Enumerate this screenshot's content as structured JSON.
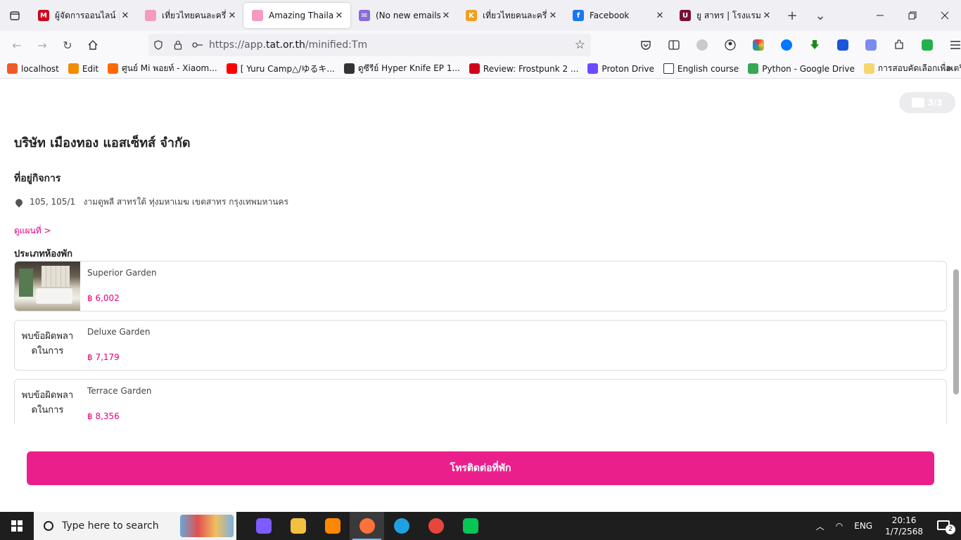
{
  "browser": {
    "tabs": [
      {
        "title": "ผู้จัดการออนไลน์ | ผ",
        "fav_color": "#d0021b",
        "fav_text": "M"
      },
      {
        "title": "เที่ยวไทยคนละครึ่ง",
        "fav_color": "#f59ac0",
        "fav_text": ""
      },
      {
        "title": "Amazing Thailand",
        "fav_color": "#f59ac0",
        "fav_text": "",
        "active": true
      },
      {
        "title": "(No new emails) -",
        "fav_color": "#8a6bd8",
        "fav_text": "✉"
      },
      {
        "title": "เที่ยวไทยคนละครึ่ง",
        "fav_color": "#f0a020",
        "fav_text": "K"
      },
      {
        "title": "Facebook",
        "fav_color": "#1877f2",
        "fav_text": "f"
      },
      {
        "title": "ยู สาทร | โรงแรม บู",
        "fav_color": "#7a0e3a",
        "fav_text": "U"
      }
    ],
    "close_glyph": "✕",
    "new_tab_glyph": "+",
    "tab_list_glyph": "⌄",
    "url_prefix": "https://app.",
    "url_domain": "tat.or.th",
    "url_path": "/minified:Tm",
    "bookmarks": [
      {
        "label": "localhost",
        "color": "#f05a28"
      },
      {
        "label": "Edit",
        "color": "#f08c00"
      },
      {
        "label": "ศูนย์ Mi พอยท์ - Xiaom...",
        "color": "#ff6900"
      },
      {
        "label": "[ Yuru Camp△/ゆるキ...",
        "color": "#ff0000"
      },
      {
        "label": "ดูซีรีย์ Hyper Knife EP 1...",
        "color": "#333333"
      },
      {
        "label": "Review: Frostpunk 2 ...",
        "color": "#d0021b"
      },
      {
        "label": "Proton Drive",
        "color": "#6d4aff"
      },
      {
        "label": "English course",
        "color": "#ffffff"
      },
      {
        "label": "Python - Google Drive",
        "color": "#34a853"
      },
      {
        "label": "การสอบคัดเลือกเพื่อเตรี...",
        "color": "#f5d76e"
      }
    ]
  },
  "page": {
    "photo_counter": "3/3",
    "company_name": "บริษัท เมืองทอง แอสเซ็ทส์ จำกัด",
    "address_heading": "ที่อยู่กิจการ",
    "address": "105, 105/1   งามดูพลี สาทรใต้ ทุ่งมหาเมฆ เขตสาทร กรุงเทพมหานคร",
    "map_link": "ดูแผนที่ >",
    "room_type_heading": "ประเภทห้องพัก",
    "rooms": [
      {
        "name": "Superior Garden",
        "price": "฿ 6,002",
        "image_error": ""
      },
      {
        "name": "Deluxe Garden",
        "price": "฿ 7,179",
        "image_error": "พบข้อผิดพลาดในการ"
      },
      {
        "name": "Terrace Garden",
        "price": "฿ 8,356",
        "image_error": "พบข้อผิดพลาดในการ"
      }
    ],
    "contact_button": "โทรติดต่อที่พัก"
  },
  "taskbar": {
    "search_placeholder": "Type here to search",
    "language": "ENG",
    "time": "20:16",
    "date": "1/7/2568",
    "notification_count": "2",
    "apps": [
      {
        "name": "copilot",
        "color": "#7c5cff"
      },
      {
        "name": "file-explorer",
        "color": "#f3c140"
      },
      {
        "name": "vlc",
        "color": "#ff8800"
      },
      {
        "name": "firefox",
        "color": "#ff7139",
        "active": true
      },
      {
        "name": "edge",
        "color": "#1fa1e0"
      },
      {
        "name": "chrome",
        "color": "#e8453c"
      },
      {
        "name": "line",
        "color": "#06c755"
      }
    ]
  }
}
